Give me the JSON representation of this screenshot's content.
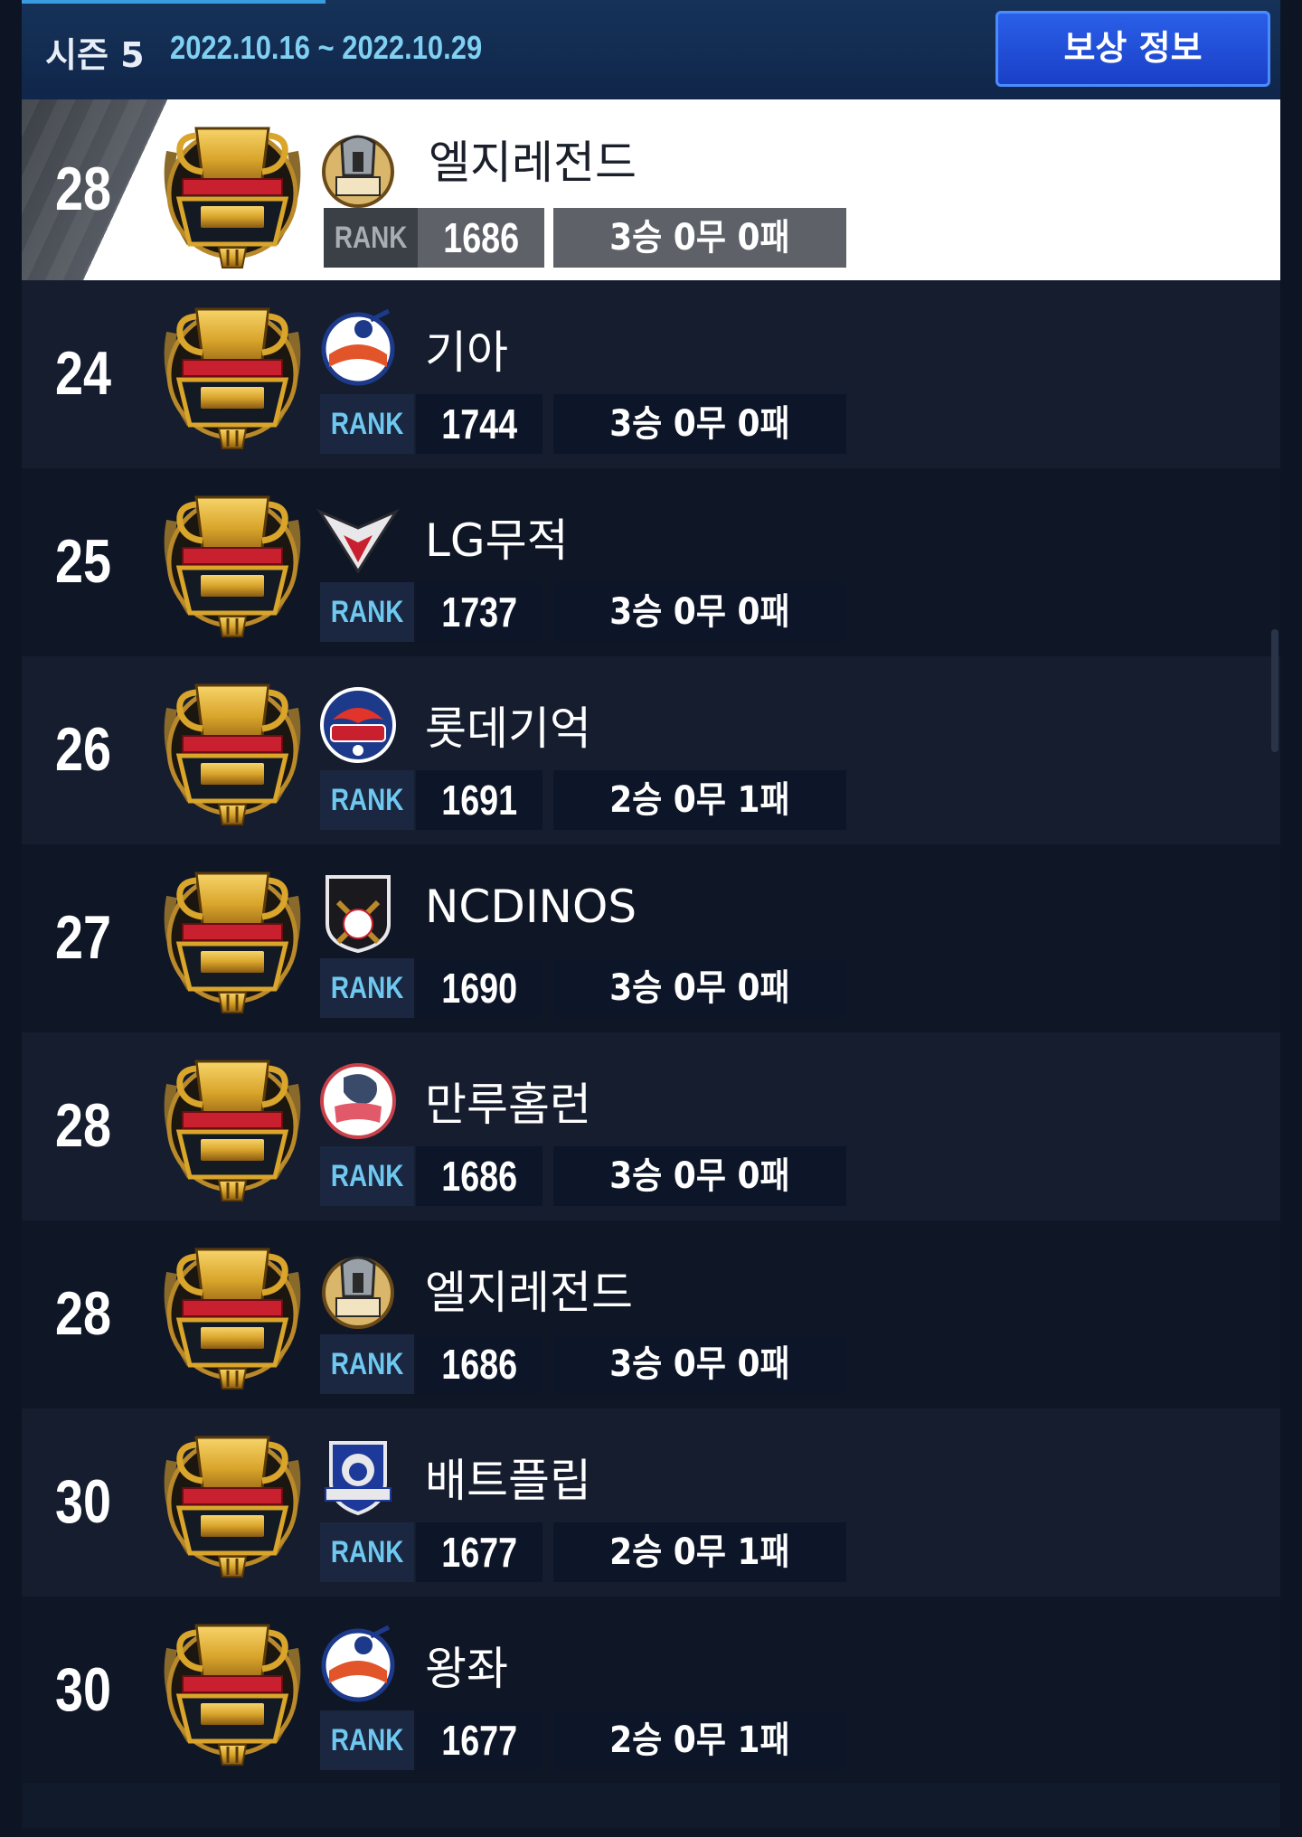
{
  "header": {
    "season_label": "시즌 5",
    "season_dates": "2022.10.16 ~ 2022.10.29",
    "reward_button": "보상 정보"
  },
  "my_row": {
    "rank": "28",
    "tier": "GOLD",
    "team": "엘지레전드",
    "rank_label": "RANK",
    "score": "1686",
    "record": "3승 0무 0패",
    "logo": "spartan-helmet-logo"
  },
  "rows": [
    {
      "rank": "24",
      "tier": "GOLD",
      "team": "기아",
      "rank_label": "RANK",
      "score": "1744",
      "record": "3승 0무 0패",
      "logo": "batter-baseball-logo"
    },
    {
      "rank": "25",
      "tier": "GOLD",
      "team": "LG무적",
      "rank_label": "RANK",
      "score": "1737",
      "record": "3승 0무 0패",
      "logo": "eagle-shield-logo"
    },
    {
      "rank": "26",
      "tier": "GOLD",
      "team": "롯데기억",
      "rank_label": "RANK",
      "score": "1691",
      "record": "2승 0무 1패",
      "logo": "eagle-circle-baseball-logo"
    },
    {
      "rank": "27",
      "tier": "GOLD",
      "team": "NCDINOS",
      "rank_label": "RANK",
      "score": "1690",
      "record": "3승 0무 0패",
      "logo": "crossed-bats-shield-logo"
    },
    {
      "rank": "28",
      "tier": "GOLD",
      "team": "만루홈런",
      "rank_label": "RANK",
      "score": "1686",
      "record": "3승 0무 0패",
      "logo": "fish-baseball-club-logo"
    },
    {
      "rank": "28",
      "tier": "GOLD",
      "team": "엘지레전드",
      "rank_label": "RANK",
      "score": "1686",
      "record": "3승 0무 0패",
      "logo": "spartan-helmet-logo"
    },
    {
      "rank": "30",
      "tier": "GOLD",
      "team": "배트플립",
      "rank_label": "RANK",
      "score": "1677",
      "record": "2승 0무 1패",
      "logo": "lion-shield-logo"
    },
    {
      "rank": "30",
      "tier": "GOLD",
      "team": "왕좌",
      "rank_label": "RANK",
      "score": "1677",
      "record": "2승 0무 1패",
      "logo": "batter-baseball-logo"
    }
  ],
  "colors": {
    "header_bg": "#163259",
    "accent_text": "#7fd0f2",
    "button_blue": "#2a5fe8",
    "row_dark": "#0f1626",
    "row_light": "#151d2e",
    "gold": "#d9a52b"
  }
}
